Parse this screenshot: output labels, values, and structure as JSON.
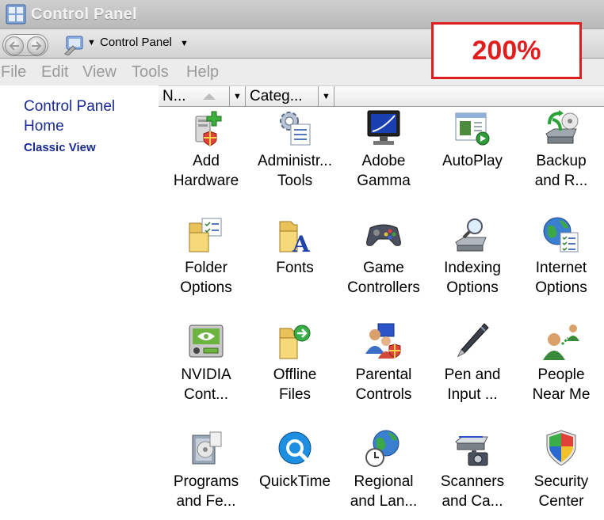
{
  "window": {
    "title": "Control Panel"
  },
  "address": {
    "location": "Control Panel"
  },
  "zoom": {
    "label": "200%"
  },
  "menu": [
    "File",
    "Edit",
    "View",
    "Tools",
    "Help"
  ],
  "sidebar": {
    "home_label": "Control Panel Home",
    "classic_label": "Classic View"
  },
  "columns": {
    "name": "N...",
    "category": "Categ..."
  },
  "items": [
    {
      "label": "Add\nHardware",
      "icon": "add-hardware-icon"
    },
    {
      "label": "Administr...\nTools",
      "icon": "administrative-tools-icon"
    },
    {
      "label": "Adobe\nGamma",
      "icon": "adobe-gamma-icon"
    },
    {
      "label": "AutoPlay",
      "icon": "autoplay-icon"
    },
    {
      "label": "Backup\nand R...",
      "icon": "backup-restore-icon"
    },
    {
      "label": "Folder\nOptions",
      "icon": "folder-options-icon"
    },
    {
      "label": "Fonts",
      "icon": "fonts-icon"
    },
    {
      "label": "Game\nControllers",
      "icon": "game-controllers-icon"
    },
    {
      "label": "Indexing\nOptions",
      "icon": "indexing-options-icon"
    },
    {
      "label": "Internet\nOptions",
      "icon": "internet-options-icon"
    },
    {
      "label": "NVIDIA\nCont...",
      "icon": "nvidia-control-panel-icon"
    },
    {
      "label": "Offline\nFiles",
      "icon": "offline-files-icon"
    },
    {
      "label": "Parental\nControls",
      "icon": "parental-controls-icon"
    },
    {
      "label": "Pen and\nInput ...",
      "icon": "pen-input-icon"
    },
    {
      "label": "People\nNear Me",
      "icon": "people-near-me-icon"
    },
    {
      "label": "Programs\nand Fe...",
      "icon": "programs-features-icon"
    },
    {
      "label": "QuickTime",
      "icon": "quicktime-icon"
    },
    {
      "label": "Regional\nand Lan...",
      "icon": "regional-language-icon"
    },
    {
      "label": "Scanners\nand Ca...",
      "icon": "scanners-cameras-icon"
    },
    {
      "label": "Security\nCenter",
      "icon": "security-center-icon"
    }
  ]
}
